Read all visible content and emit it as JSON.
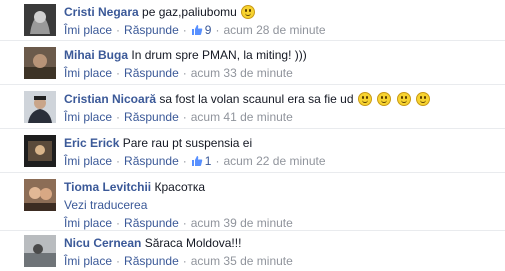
{
  "actions": {
    "like": "Îmi place",
    "reply": "Răspunde",
    "separator": "·"
  },
  "comments": [
    {
      "author": "Cristi Negara",
      "text": "pe gaz,paliubomu",
      "emoji": "smiley-icon",
      "likes": "9",
      "time": "acum 28 de minute"
    },
    {
      "author": "Mihai Buga",
      "text": "In drum spre PMAN, la miting! )))",
      "time": "acum 33 de minute"
    },
    {
      "author": "Cristian Nicoară",
      "text": "sa fost la volan scaunul era sa fie ud",
      "emoji_count": 4,
      "time": "acum 41 de minute"
    },
    {
      "author": "Eric Erick",
      "text": "Pare rau pt suspensia ei",
      "likes": "1",
      "time": "acum 22 de minute"
    },
    {
      "author": "Tioma Levitchii",
      "text": "Красотка",
      "translate": "Vezi traducerea",
      "time": "acum 39 de minute"
    },
    {
      "author": "Nicu Cernean",
      "text": "Săraca Moldova!!!",
      "time": "acum 35 de minute"
    }
  ],
  "colors": {
    "link": "#3b5998",
    "meta": "#90949c",
    "text": "#141823",
    "divider": "#e9ebee"
  }
}
